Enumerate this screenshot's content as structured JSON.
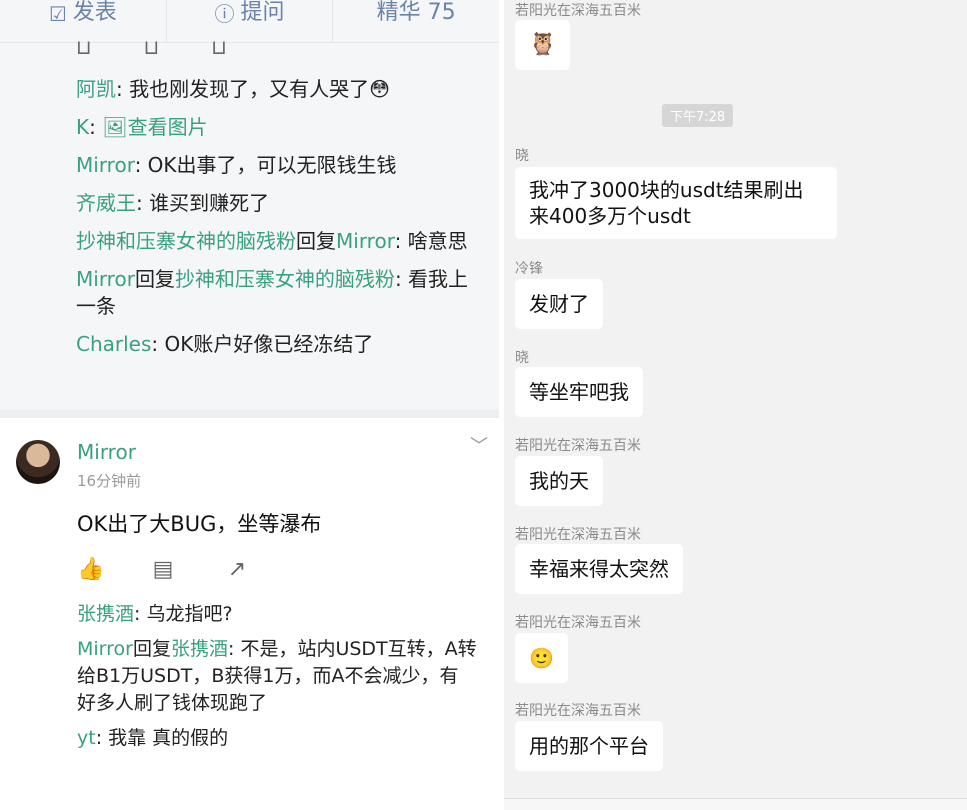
{
  "left": {
    "topbar": [
      {
        "icon": "edit-icon",
        "label": "发表"
      },
      {
        "icon": "question-icon",
        "label": "提问"
      },
      {
        "icon": "",
        "label": "精华 75"
      }
    ],
    "comments": [
      {
        "user": "阿凯",
        "text": ": 我也刚发现了，又有人哭了",
        "emoji": "😳"
      },
      {
        "user": "K",
        "text": ": ",
        "extra": "查看图片"
      },
      {
        "user": "Mirror",
        "text": ": OK出事了，可以无限钱生钱"
      },
      {
        "user": "齐威王",
        "text": ": 谁买到赚死了"
      },
      {
        "user": "抄神和压寨女神的脑残粉",
        "reply": "回复",
        "target": "Mirror",
        "text": ": 啥意思"
      },
      {
        "user": "Mirror",
        "reply": "回复",
        "target": "抄神和压寨女神的脑残粉",
        "text": ": 看我上一条"
      },
      {
        "user": "Charles",
        "text": ": OK账户好像已经冻结了"
      }
    ],
    "post": {
      "author": "Mirror",
      "time": "16分钟前",
      "text": "OK出了大BUG，坐等瀑布",
      "comments": [
        {
          "user": "张携酒",
          "text": ": 乌龙指吧?"
        },
        {
          "user": "Mirror",
          "reply": "回复",
          "target": "张携酒",
          "text": ": 不是，站内USDT互转，A转给B1万USDT，B获得1万，而A不会减少，有好多人刷了钱体现跑了"
        },
        {
          "user": "yt",
          "text": ": 我靠 真的假的"
        }
      ]
    }
  },
  "right": {
    "time_chip": "下午7:28",
    "messages": [
      {
        "sender": "若阳光在深海五百米",
        "text": "🦉"
      },
      {
        "sender": "晓",
        "text": "我冲了3000块的usdt结果刷出来400多万个usdt"
      },
      {
        "sender": "冷锋",
        "text": "发财了"
      },
      {
        "sender": "晓",
        "text": "等坐牢吧我"
      },
      {
        "sender": "若阳光在深海五百米",
        "text": "我的天"
      },
      {
        "sender": "若阳光在深海五百米",
        "text": "幸福来得太突然"
      },
      {
        "sender": "若阳光在深海五百米",
        "text": "🙂"
      },
      {
        "sender": "若阳光在深海五百米",
        "text": "用的那个平台"
      }
    ]
  }
}
